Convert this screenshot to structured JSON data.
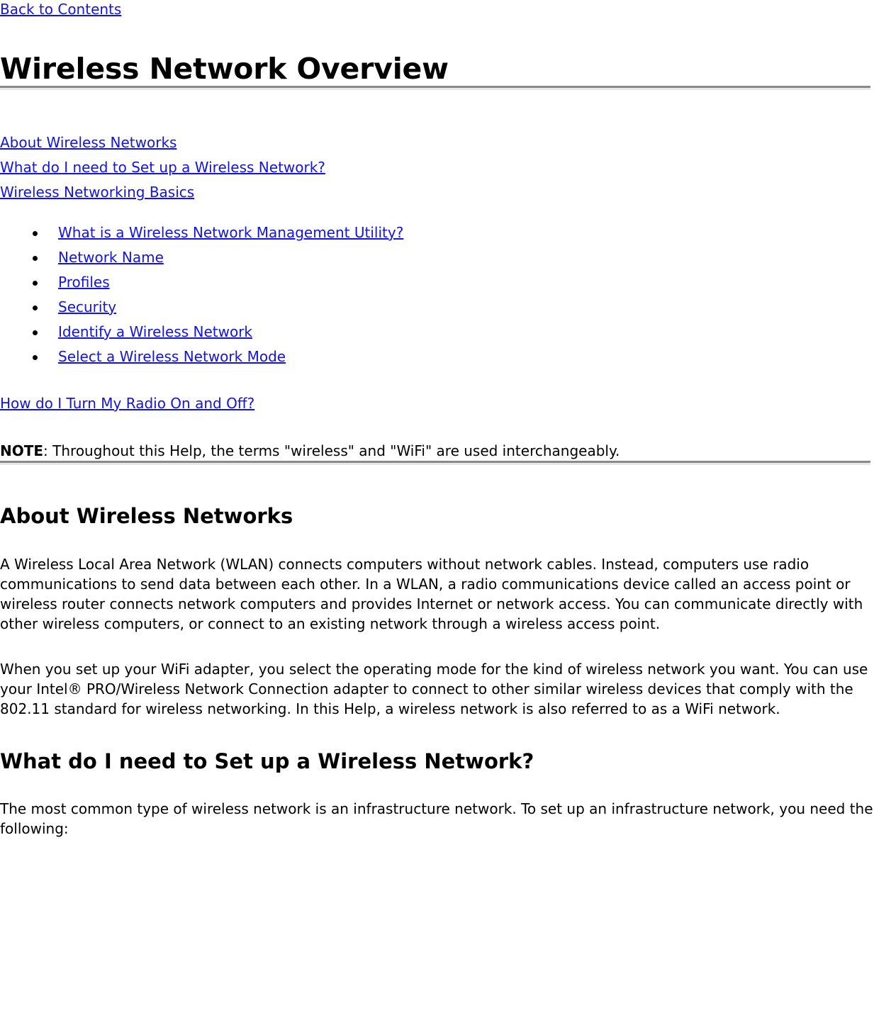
{
  "colors": {
    "link": "#1414dc",
    "text": "#000000",
    "rule_top": "#8a8a8a",
    "rule_bottom": "#e8e8e8",
    "background": "#ffffff"
  },
  "back_link": {
    "label": "Back to Contents"
  },
  "title": "Wireless Network Overview",
  "toc": {
    "links": [
      {
        "label": "About Wireless Networks"
      },
      {
        "label": "What do I need to Set up a Wireless Network?"
      },
      {
        "label": "Wireless Networking Basics"
      }
    ],
    "sub_items": [
      {
        "label": "What is a Wireless Network Management Utility?"
      },
      {
        "label": "Network Name"
      },
      {
        "label": "Profiles"
      },
      {
        "label": "Security"
      },
      {
        "label": "Identify a Wireless Network"
      },
      {
        "label": "Select a Wireless Network Mode"
      }
    ],
    "radio_link": {
      "label": "How do I Turn My Radio On and Off?"
    }
  },
  "note": {
    "label": "NOTE",
    "text": ": Throughout this Help, the terms \"wireless\" and \"WiFi\" are used interchangeably."
  },
  "sections": [
    {
      "heading": "About Wireless Networks",
      "paragraphs": [
        "A Wireless Local Area Network (WLAN) connects computers without network cables. Instead, computers use radio communications to send data between each other. In a WLAN, a radio communications device called an access point or wireless router connects network computers and provides Internet or network access. You can communicate directly with other wireless computers, or connect to an existing network through a wireless access point.",
        "When you set up your WiFi adapter, you select the operating mode for the kind of wireless network you want. You can use your Intel® PRO/Wireless Network Connection adapter to connect to other similar wireless devices that comply with the 802.11 standard for wireless networking. In this Help, a wireless network is also referred to as a WiFi network."
      ]
    },
    {
      "heading": "What do I need to Set up a Wireless Network?",
      "paragraphs": [
        "The most common type of wireless network is an infrastructure network. To set up an infrastructure network, you need the following:"
      ]
    }
  ]
}
